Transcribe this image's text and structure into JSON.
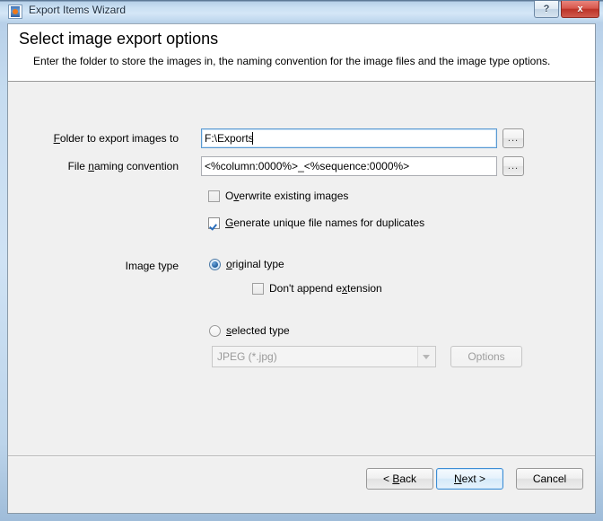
{
  "window": {
    "title": "Export Items Wizard",
    "icon": "export-wizard-icon",
    "help_label": "?",
    "close_label": "x",
    "accent_focus": "#3c8dd4",
    "titlebar_color": "#cfe2f4",
    "body_color": "#f0f0f0"
  },
  "header": {
    "title": "Select image export options",
    "subtitle": "Enter the folder to store the images in, the naming convention for the image files and the image type options."
  },
  "form": {
    "folder": {
      "label_prefix": "",
      "label_accel": "F",
      "label_suffix": "older to export images to",
      "value": "F:\\Exports",
      "placeholder": "",
      "focused": true,
      "browse_label": "..."
    },
    "naming": {
      "label_prefix": "File ",
      "label_accel": "n",
      "label_suffix": "aming convention",
      "value": "<%column:0000%>_<%sequence:0000%>",
      "placeholder": "",
      "focused": false,
      "browse_label": "..."
    },
    "overwrite": {
      "label_prefix": "O",
      "label_accel": "v",
      "label_suffix": "erwrite existing images",
      "checked": false
    },
    "unique_names": {
      "label_prefix": "",
      "label_accel": "G",
      "label_suffix": "enerate unique file names for duplicates",
      "checked": true
    },
    "image_type": {
      "label": "Image type",
      "original": {
        "label_prefix": "",
        "label_accel": "o",
        "label_suffix": "riginal type",
        "selected": true
      },
      "no_extension": {
        "label_prefix": "Don't append e",
        "label_accel": "x",
        "label_suffix": "tension",
        "checked": false
      },
      "selected_type": {
        "label_prefix": "",
        "label_accel": "s",
        "label_suffix": "elected type",
        "selected": false
      },
      "combo": {
        "value": "JPEG (*.jpg)",
        "enabled": false
      },
      "options_button": {
        "label": "Options",
        "enabled": false
      }
    }
  },
  "footer": {
    "back": {
      "prefix": "< ",
      "accel": "B",
      "suffix": "ack",
      "default": false
    },
    "next": {
      "prefix": "",
      "accel": "N",
      "suffix": "ext >",
      "default": true
    },
    "cancel": {
      "prefix": "Cancel",
      "accel": "",
      "suffix": "",
      "default": false
    }
  }
}
